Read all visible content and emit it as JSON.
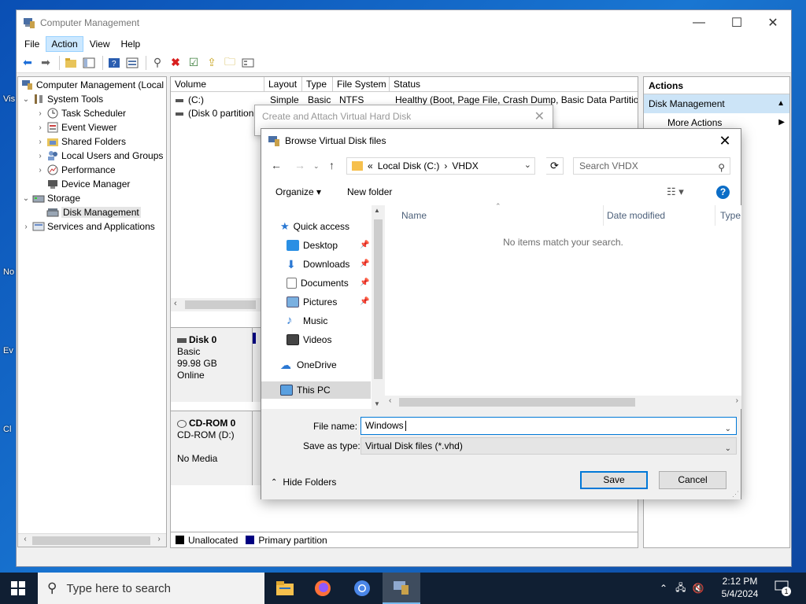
{
  "window": {
    "title": "Computer Management",
    "controls": {
      "minimize": "—",
      "maximize": "☐",
      "close": "✕"
    }
  },
  "menu": [
    "File",
    "Action",
    "View",
    "Help"
  ],
  "menu_active": "Action",
  "toolbar_icons": [
    "back-icon",
    "forward-icon",
    "up-folder-icon",
    "show-hide-tree-icon",
    "help-icon",
    "properties-icon",
    "connect-icon",
    "delete-icon",
    "checklist-icon",
    "export-icon",
    "open-icon",
    "view-icon"
  ],
  "tree": {
    "root": "Computer Management (Local",
    "system_tools": "System Tools",
    "task_scheduler": "Task Scheduler",
    "event_viewer": "Event Viewer",
    "shared_folders": "Shared Folders",
    "local_users": "Local Users and Groups",
    "performance": "Performance",
    "device_manager": "Device Manager",
    "storage": "Storage",
    "disk_management": "Disk Management",
    "services": "Services and Applications"
  },
  "volume_list": {
    "headers": [
      "Volume",
      "Layout",
      "Type",
      "File System",
      "Status"
    ],
    "rows": [
      {
        "volume": "(C:)",
        "layout": "Simple",
        "type": "Basic",
        "fs": "NTFS",
        "status": "Healthy (Boot, Page File, Crash Dump, Basic Data Partition)"
      },
      {
        "volume": "(Disk 0 partition",
        "layout": "",
        "type": "",
        "fs": "",
        "status": ""
      }
    ]
  },
  "disks": [
    {
      "name": "Disk 0",
      "line1": "Basic",
      "line2": "99.98 GB",
      "line3": "Online"
    },
    {
      "name": "CD-ROM 0",
      "line1": "CD-ROM (D:)",
      "line2": "",
      "line3": "No Media"
    }
  ],
  "legend": [
    {
      "label": "Unallocated",
      "color": "#000000"
    },
    {
      "label": "Primary partition",
      "color": "#000080"
    }
  ],
  "actions": {
    "header": "Actions",
    "section": "Disk Management",
    "item": "More Actions"
  },
  "ghost_dialog": {
    "title": "Create and Attach Virtual Hard Disk",
    "close": "✕"
  },
  "file_dialog": {
    "title": "Browse Virtual Disk files",
    "close": "✕",
    "path": [
      "«",
      "Local Disk (C:)",
      "›",
      "VHDX"
    ],
    "search_placeholder": "Search VHDX",
    "organize": "Organize ▾",
    "new_folder": "New folder",
    "nav": [
      {
        "label": "Quick access",
        "icon": "star-icon",
        "pinned": false
      },
      {
        "label": "Desktop",
        "icon": "desktop-icon",
        "pinned": true
      },
      {
        "label": "Downloads",
        "icon": "download-icon",
        "pinned": true
      },
      {
        "label": "Documents",
        "icon": "documents-icon",
        "pinned": true
      },
      {
        "label": "Pictures",
        "icon": "pictures-icon",
        "pinned": true
      },
      {
        "label": "Music",
        "icon": "music-icon",
        "pinned": false
      },
      {
        "label": "Videos",
        "icon": "videos-icon",
        "pinned": false
      },
      {
        "label": "OneDrive",
        "icon": "cloud-icon",
        "pinned": false
      },
      {
        "label": "This PC",
        "icon": "pc-icon",
        "pinned": false
      }
    ],
    "columns": [
      "Name",
      "Date modified",
      "Type"
    ],
    "empty_message": "No items match your search.",
    "file_name_label": "File name:",
    "file_name_value": "Windows",
    "save_type_label": "Save as type:",
    "save_type_value": "Virtual Disk files (*.vhd)",
    "hide_folders": "Hide Folders",
    "save_label": "Save",
    "cancel_label": "Cancel"
  },
  "desktop_labels": [
    "Vis",
    "No",
    "Ev",
    "Cl"
  ],
  "taskbar": {
    "search_placeholder": "Type here to search",
    "time": "2:12 PM",
    "date": "5/4/2024",
    "notification_count": "1"
  },
  "colors": {
    "accent": "#0078d7",
    "taskbar": "#101f33",
    "selection": "#cce4f7"
  }
}
